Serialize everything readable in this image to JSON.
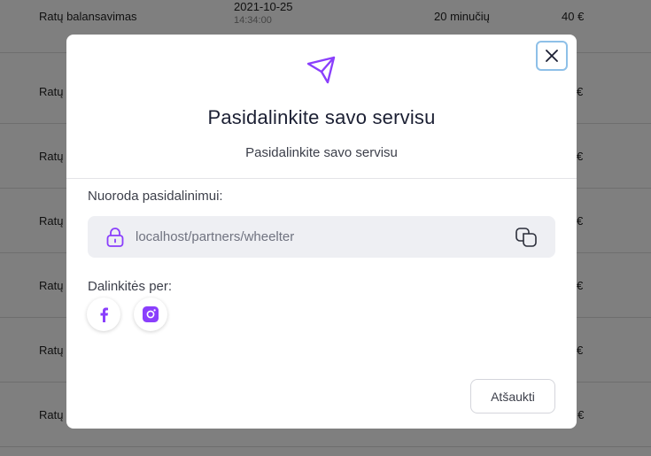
{
  "background_table": {
    "rows": [
      {
        "name": "Ratų balansavimas",
        "date": "2021-10-25",
        "time": "14:34:00",
        "duration": "20 minučių",
        "price": "40 €"
      },
      {
        "name": "Ratų",
        "price": "€"
      },
      {
        "name": "Ratų",
        "price": "€"
      },
      {
        "name": "Ratų",
        "price": "€"
      },
      {
        "name": "Ratų",
        "price": "€"
      },
      {
        "name": "Ratų",
        "price": "€"
      },
      {
        "name": "Ratų",
        "price": "40 €"
      }
    ]
  },
  "modal": {
    "title": "Pasidalinkite savo servisu",
    "subtitle": "Pasidalinkite savo servisu",
    "link_label": "Nuoroda pasidalinimui:",
    "link_value": "localhost/partners/wheelter",
    "share_label": "Dalinkitės per:",
    "cancel_label": "Atšaukti",
    "icons": {
      "header": "send-icon",
      "close": "close-icon",
      "lock": "lock-icon",
      "copy": "copy-icon",
      "facebook": "facebook-icon",
      "instagram": "instagram-icon"
    },
    "accent_color": "#8a3ffc"
  }
}
